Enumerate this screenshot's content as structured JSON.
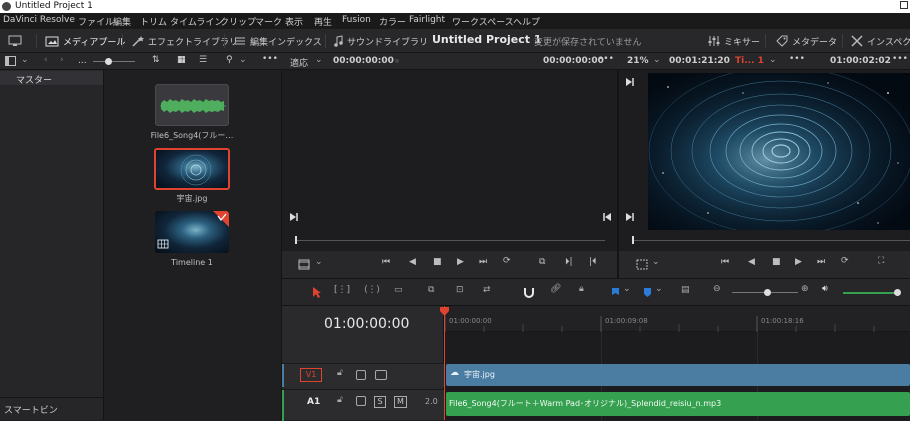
{
  "window": {
    "title": "Untitled Project 1"
  },
  "menu": [
    "DaVinci Resolve",
    "ファイル",
    "編集",
    "トリム",
    "タイムライン",
    "クリップ",
    "マーク",
    "表示",
    "再生",
    "Fusion",
    "カラー",
    "Fairlight",
    "ワークスペース",
    "ヘルプ"
  ],
  "toolbar": {
    "media_pool": "メディアプール",
    "effects_library": "エフェクトライブラリ",
    "edit_index": "編集インデックス",
    "sound_library": "サウンドライブラリ",
    "project_name": "Untitled Project 1",
    "unsaved_status": "変更が保存されていません",
    "mixer": "ミキサー",
    "metadata": "メタデータ",
    "inspector": "インスペクタ"
  },
  "bins": {
    "master": "マスター",
    "smart_bins": "スマートビン",
    "path": "..."
  },
  "clips": [
    {
      "name": "File6_Song4(フルー…",
      "type": "audio"
    },
    {
      "name": "宇宙.jpg",
      "type": "image",
      "selected": true
    },
    {
      "name": "Timeline 1",
      "type": "timeline"
    }
  ],
  "source_viewer": {
    "fit": "適応",
    "timecode_left": "00:00:00:00",
    "timecode_right": "00:00:00:00"
  },
  "timeline_viewer": {
    "zoom": "21%",
    "duration": "00:01:21:20",
    "timeline_name": "Ti... 1",
    "timecode": "01:00:02:02"
  },
  "timeline": {
    "current_timecode": "01:00:00:00",
    "ruler": [
      "01:00:00:00",
      "01:00:09:08",
      "01:00:18:16"
    ],
    "tracks": [
      {
        "id": "V1",
        "clip": "宇宙.jpg",
        "kind": "video"
      },
      {
        "id": "A1",
        "level": "2.0",
        "clip": "File6_Song4(フルート＋Warm  Pad･オリジナル)_Splendid_reisiu_n.mp3",
        "kind": "audio",
        "solo": "S",
        "mute": "M"
      }
    ]
  },
  "colors": {
    "playhead": "#e0432f",
    "video_clip": "#4b7da3",
    "audio_clip": "#35a04f",
    "selection": "#e0432f",
    "flag_blue": "#2b7bd8"
  }
}
